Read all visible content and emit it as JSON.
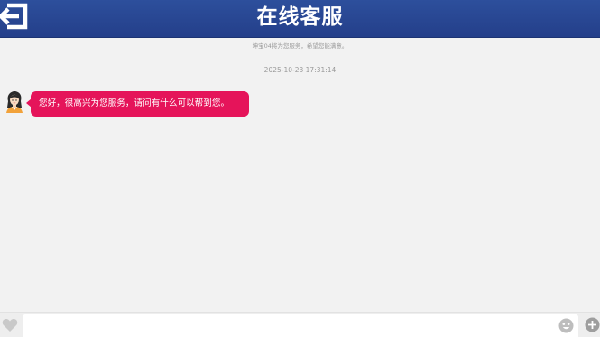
{
  "header": {
    "title": "在线客服",
    "back_icon": "back-arrow-icon",
    "background_color": "#2a4894"
  },
  "chat": {
    "notice": "坤宝04将为您服务，希望您能满意。",
    "timestamp": "2025-10-23 17:31:14",
    "messages": [
      {
        "sender": "agent",
        "avatar_icon": "agent-avatar-icon",
        "text": "您好，很高兴为您服务，请问有什么可以帮到您。",
        "bubble_color": "#e5145a"
      }
    ]
  },
  "footer": {
    "heart_icon": "heart-icon",
    "input_value": "",
    "input_placeholder": "",
    "emoji_icon": "emoji-icon",
    "add_icon": "plus-icon"
  }
}
